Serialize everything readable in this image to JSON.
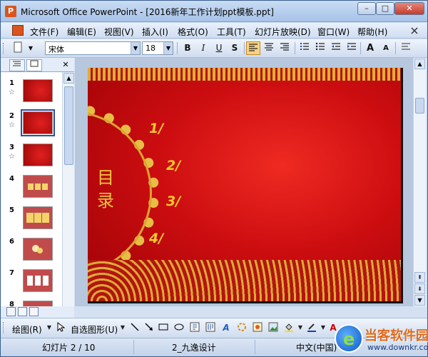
{
  "window": {
    "title": "Microsoft Office PowerPoint - [2016新年工作计划ppt模板.ppt]",
    "app_icon": "P",
    "controls": {
      "minimize": "–",
      "maximize": "□",
      "close": "✕"
    }
  },
  "menu": {
    "items": [
      "文件(F)",
      "编辑(E)",
      "视图(V)",
      "插入(I)",
      "格式(O)",
      "工具(T)",
      "幻灯片放映(D)",
      "窗口(W)",
      "帮助(H)"
    ]
  },
  "toolbar": {
    "font_name": "宋体",
    "font_size": "18",
    "bold": "B",
    "italic": "I",
    "underline": "U",
    "shadow": "S",
    "align_left_active": true,
    "grow_font": "A",
    "shrink_font": "A"
  },
  "left_panel": {
    "slides": [
      {
        "number": "1",
        "star": "☆"
      },
      {
        "number": "2",
        "star": "☆",
        "selected": true
      },
      {
        "number": "3",
        "star": "☆"
      },
      {
        "number": "4",
        "star": ""
      },
      {
        "number": "5",
        "star": ""
      },
      {
        "number": "6",
        "star": ""
      },
      {
        "number": "7",
        "star": ""
      },
      {
        "number": "8",
        "star": ""
      }
    ]
  },
  "slide": {
    "title": "目录",
    "items": [
      "1/",
      "2/",
      "3/",
      "4/"
    ]
  },
  "drawbar": {
    "draw_label": "绘图(R)",
    "autoshape_label": "自选图形(U)"
  },
  "status": {
    "slide_position": "幻灯片 2 / 10",
    "design": "2_九逸设计",
    "language": "中文(中国)"
  },
  "watermark": {
    "name": "当客软件园",
    "url": "www.downkr.com"
  },
  "colors": {
    "slide_red": "#cc0d10",
    "gold": "#e8bd45",
    "number_yellow": "#f4c92a"
  }
}
